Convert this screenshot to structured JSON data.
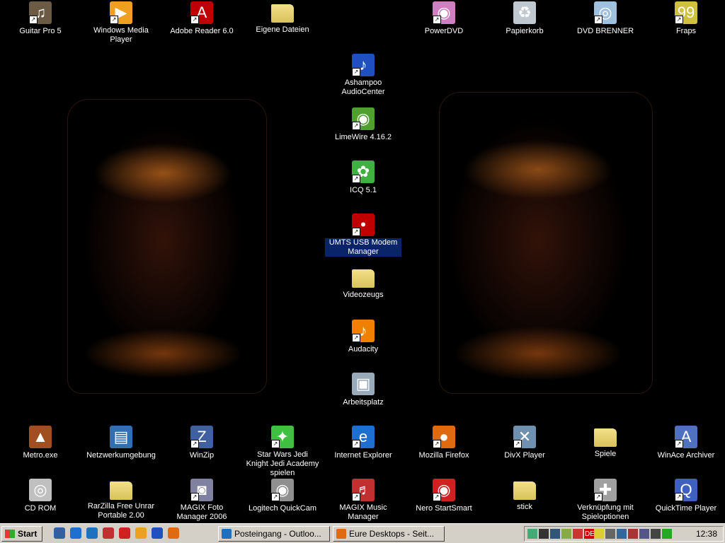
{
  "desktop_icons": [
    {
      "label": "Guitar Pro 5",
      "icon": "guitar-pro-icon",
      "color": "#6b5b45"
    },
    {
      "label": "Windows Media Player",
      "icon": "windows-media-player-icon",
      "color": "#f0a020"
    },
    {
      "label": "Adobe Reader 6.0",
      "icon": "adobe-reader-icon",
      "color": "#c00000"
    },
    {
      "label": "Eigene Dateien",
      "icon": "folder-documents-icon",
      "color": "#f2e08a"
    },
    {
      "label": "PowerDVD",
      "icon": "powerdvd-icon",
      "color": "#d080c0"
    },
    {
      "label": "Papierkorb",
      "icon": "recycle-bin-icon",
      "color": "#c0c8d0"
    },
    {
      "label": "DVD  BRENNER",
      "icon": "dvd-burner-icon",
      "color": "#a0c0e0"
    },
    {
      "label": "Fraps",
      "icon": "fraps-icon",
      "color": "#d0c040"
    },
    {
      "label": "Ashampoo AudioCenter",
      "icon": "ashampoo-audiocenter-icon",
      "color": "#2050c0"
    },
    {
      "label": "LimeWire 4.16.2",
      "icon": "limewire-icon",
      "color": "#50a030"
    },
    {
      "label": "ICQ 5.1",
      "icon": "icq-icon",
      "color": "#40b040"
    },
    {
      "label": "UMTS USB Modem Manager",
      "icon": "umts-modem-icon",
      "color": "#c00000"
    },
    {
      "label": "Videozeugs",
      "icon": "folder-icon",
      "color": "#f2e08a"
    },
    {
      "label": "Audacity",
      "icon": "audacity-icon",
      "color": "#f08000"
    },
    {
      "label": "Arbeitsplatz",
      "icon": "my-computer-icon",
      "color": "#9ab"
    },
    {
      "label": "Metro.exe",
      "icon": "metronome-icon",
      "color": "#a05020"
    },
    {
      "label": "Netzwerkumgebung",
      "icon": "network-icon",
      "color": "#3070b0"
    },
    {
      "label": "WinZip",
      "icon": "winzip-icon",
      "color": "#4060a0"
    },
    {
      "label": "Star Wars Jedi Knight Jedi Academy spielen",
      "icon": "jedi-academy-icon",
      "color": "#40c040"
    },
    {
      "label": "Internet Explorer",
      "icon": "internet-explorer-icon",
      "color": "#1e6fd0"
    },
    {
      "label": "Mozilla Firefox",
      "icon": "firefox-icon",
      "color": "#e06a10"
    },
    {
      "label": "DivX Player",
      "icon": "divx-player-icon",
      "color": "#7090b0"
    },
    {
      "label": "Spiele",
      "icon": "folder-icon",
      "color": "#f2e08a"
    },
    {
      "label": "WinAce Archiver",
      "icon": "winace-icon",
      "color": "#5070c0"
    },
    {
      "label": "CD ROM",
      "icon": "cd-rom-icon",
      "color": "#c0c0c0"
    },
    {
      "label": "RarZilla Free Unrar Portable 2.00",
      "icon": "folder-icon",
      "color": "#f2e08a"
    },
    {
      "label": "MAGIX Foto Manager 2006",
      "icon": "magix-foto-icon",
      "color": "#8080a0"
    },
    {
      "label": "Logitech QuickCam",
      "icon": "webcam-icon",
      "color": "#909090"
    },
    {
      "label": "MAGIX Music Manager",
      "icon": "magix-music-icon",
      "color": "#c03030"
    },
    {
      "label": "Nero StartSmart",
      "icon": "nero-icon",
      "color": "#d02020"
    },
    {
      "label": "stick",
      "icon": "folder-icon",
      "color": "#f2e08a"
    },
    {
      "label": "Verknüpfung mit Spieloptionen",
      "icon": "joystick-icon",
      "color": "#a0a0a0"
    },
    {
      "label": "QuickTime Player",
      "icon": "quicktime-icon",
      "color": "#4060c0"
    }
  ],
  "taskbar": {
    "start_label": "Start",
    "quick_launch": [
      {
        "icon": "show-desktop-icon",
        "color": "#3060a0"
      },
      {
        "icon": "internet-explorer-icon",
        "color": "#1e6fd0"
      },
      {
        "icon": "outlook-icon",
        "color": "#2070c0"
      },
      {
        "icon": "media-icon",
        "color": "#c03030"
      },
      {
        "icon": "nero-icon",
        "color": "#d02020"
      },
      {
        "icon": "windows-media-player-icon",
        "color": "#f0a020"
      },
      {
        "icon": "ashampoo-audiocenter-icon",
        "color": "#2050c0"
      },
      {
        "icon": "firefox-icon",
        "color": "#e06a10"
      }
    ],
    "tasks": [
      {
        "label": "Posteingang - Outloo...",
        "icon": "outlook-icon",
        "active": false
      },
      {
        "label": "Eure Desktops - Seit...",
        "icon": "firefox-icon",
        "active": false
      }
    ],
    "tray": {
      "language": "DE",
      "icons": [
        "network-icon",
        "volume-icon",
        "usb-icon",
        "display-icon",
        "language-icon",
        "security-icon",
        "printer-icon",
        "update-icon",
        "zone-alarm-icon",
        "card-icon",
        "monitor-icon",
        "clover-icon"
      ],
      "clock": "12:38"
    }
  }
}
